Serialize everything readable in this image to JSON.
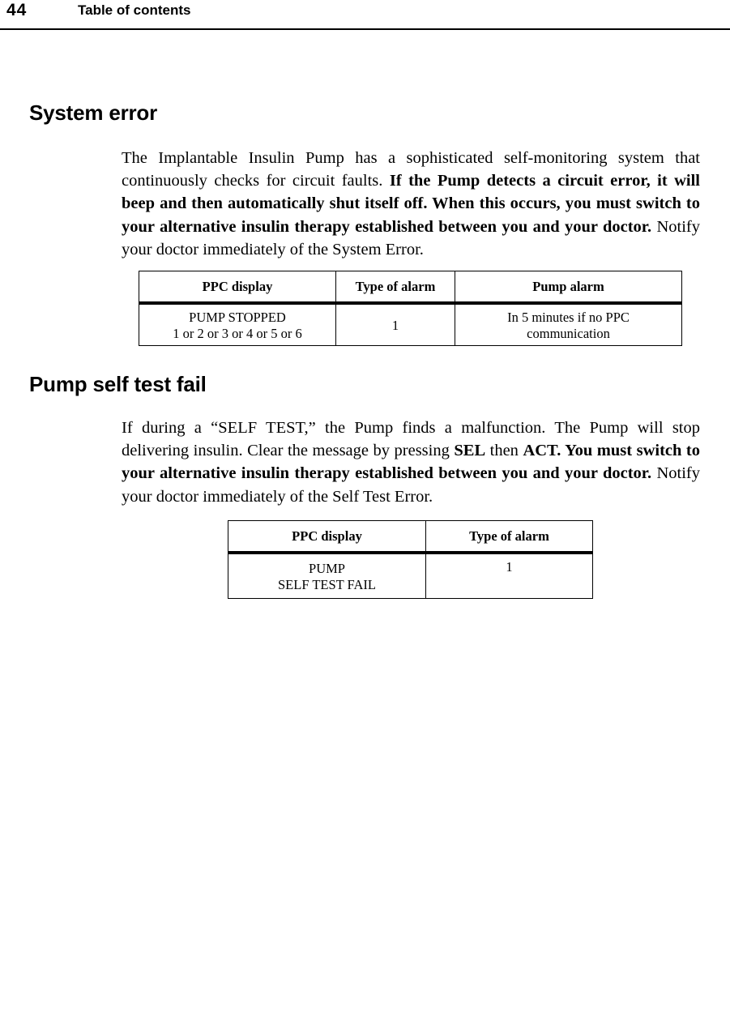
{
  "header": {
    "page_number": "44",
    "title": "Table of contents"
  },
  "sections": [
    {
      "heading": "System error",
      "paragraph": {
        "part1_regular": "The Implantable Insulin Pump has a sophisticated self-monitoring system that continuously checks for circuit faults. ",
        "part2_bold": "If the Pump detects a circuit error, it will beep and then automatically shut itself off. When this occurs, you must switch to your alternative insulin therapy established between you and your doctor.",
        "part3_regular": " Notify your doctor immediately of the System Error."
      },
      "table": {
        "headers": [
          "PPC display",
          "Type of alarm",
          "Pump alarm"
        ],
        "rows": [
          {
            "ppc_display_line1": "PUMP STOPPED",
            "ppc_display_line2": "1 or 2 or 3 or 4 or 5 or 6",
            "type_of_alarm": "1",
            "pump_alarm_line1": "In 5 minutes if no PPC",
            "pump_alarm_line2": "communication"
          }
        ]
      }
    },
    {
      "heading": "Pump self test fail",
      "paragraph": {
        "part1_regular": "If during a “SELF TEST,” the Pump finds a malfunction. The Pump will stop delivering insulin. Clear the message by pressing ",
        "part2_bold": "SEL",
        "part3_regular": " then ",
        "part4_bold": "ACT. You must switch to your alternative insulin therapy established between you and your doctor.",
        "part5_regular": " Notify your doctor immediately of the Self Test Error."
      },
      "table": {
        "headers": [
          "PPC display",
          "Type of alarm"
        ],
        "rows": [
          {
            "ppc_display_line1": "PUMP",
            "ppc_display_line2": "SELF TEST FAIL",
            "type_of_alarm": "1"
          }
        ]
      }
    }
  ]
}
